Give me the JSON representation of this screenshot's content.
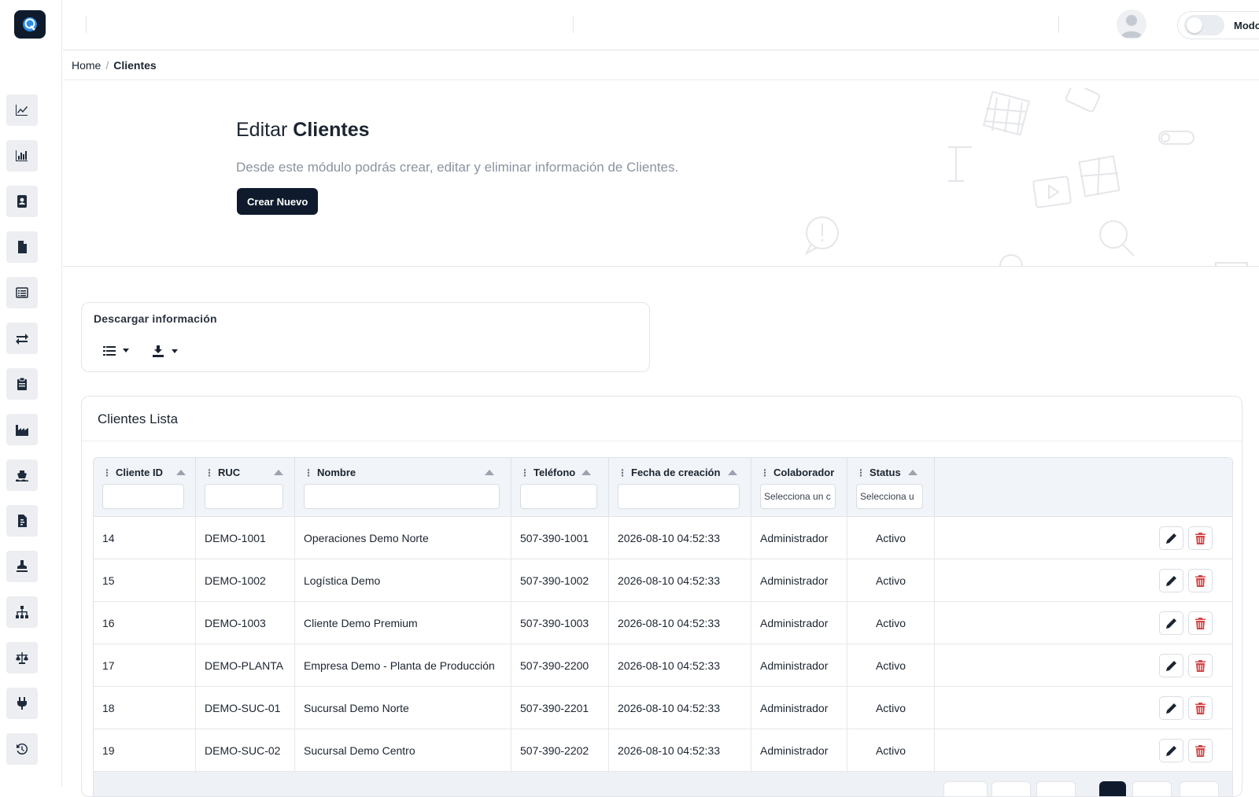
{
  "topbar": {
    "mode_label": "Modo claro"
  },
  "breadcrumb": {
    "home": "Home",
    "separator": "/",
    "current": "Clientes"
  },
  "hero": {
    "title_prefix": "Editar",
    "title_bold": "Clientes",
    "subtitle": "Desde este módulo podrás crear, editar y eliminar información de Clientes.",
    "create_button": "Crear Nuevo"
  },
  "download": {
    "title": "Descargar información"
  },
  "list": {
    "title_prefix": "Clientes",
    "title_bold": "Lista",
    "columns": [
      "Cliente ID",
      "RUC",
      "Nombre",
      "Teléfono",
      "Fecha de creación",
      "Colaborador",
      "Status"
    ],
    "filters": {
      "colaborador_placeholder": "Selecciona un c",
      "status_placeholder": "Selecciona u"
    },
    "rows": [
      {
        "id": "14",
        "ruc": "DEMO-1001",
        "nombre": "Operaciones Demo Norte",
        "telefono": "507-390-1001",
        "fecha": "2026-08-10 04:52:33",
        "colaborador": "Administrador",
        "status": "Activo"
      },
      {
        "id": "15",
        "ruc": "DEMO-1002",
        "nombre": "Logística Demo",
        "telefono": "507-390-1002",
        "fecha": "2026-08-10 04:52:33",
        "colaborador": "Administrador",
        "status": "Activo"
      },
      {
        "id": "16",
        "ruc": "DEMO-1003",
        "nombre": "Cliente Demo Premium",
        "telefono": "507-390-1003",
        "fecha": "2026-08-10 04:52:33",
        "colaborador": "Administrador",
        "status": "Activo"
      },
      {
        "id": "17",
        "ruc": "DEMO-PLANTA",
        "nombre": "Empresa Demo - Planta de Producción",
        "telefono": "507-390-2200",
        "fecha": "2026-08-10 04:52:33",
        "colaborador": "Administrador",
        "status": "Activo"
      },
      {
        "id": "18",
        "ruc": "DEMO-SUC-01",
        "nombre": "Sucursal Demo Norte",
        "telefono": "507-390-2201",
        "fecha": "2026-08-10 04:52:33",
        "colaborador": "Administrador",
        "status": "Activo"
      },
      {
        "id": "19",
        "ruc": "DEMO-SUC-02",
        "nombre": "Sucursal Demo Centro",
        "telefono": "507-390-2202",
        "fecha": "2026-08-10 04:52:33",
        "colaborador": "Administrador",
        "status": "Activo"
      }
    ]
  },
  "sidebar": {
    "icons": [
      "chart-line-icon",
      "bar-chart-icon",
      "contact-book-icon",
      "file-icon",
      "list-icon",
      "transfer-icon",
      "clipboard-icon",
      "industry-icon",
      "ship-icon",
      "document-icon",
      "stamp-icon",
      "sitemap-icon",
      "scale-icon",
      "plug-icon",
      "history-icon"
    ]
  },
  "colors": {
    "primary": "#0f1b2d",
    "delete": "#d64545",
    "header_bg": "#f1f4f8"
  }
}
